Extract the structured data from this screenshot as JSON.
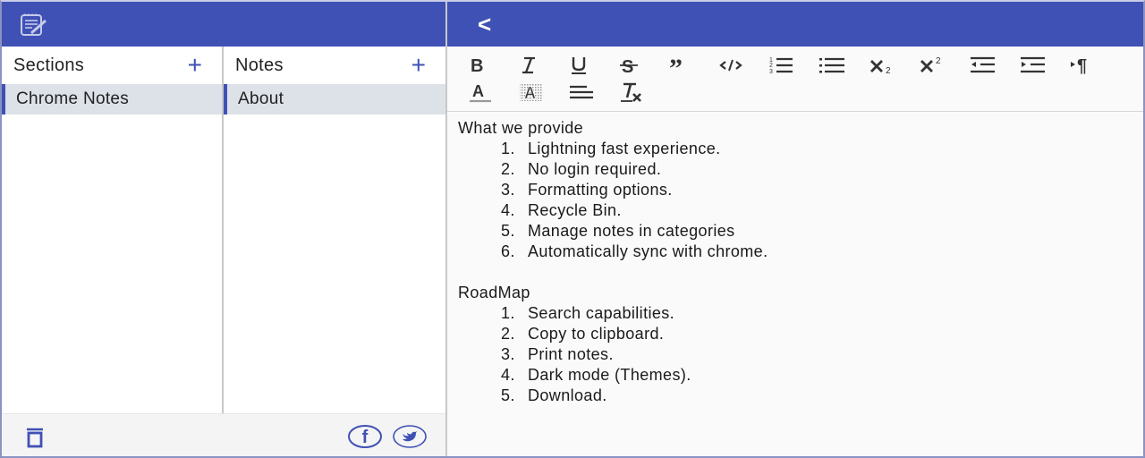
{
  "app": {
    "brand_color": "#3f51b5",
    "icon": "notepad-pencil-icon"
  },
  "sections": {
    "title": "Sections",
    "add_label": "+",
    "items": [
      {
        "label": "Chrome Notes",
        "selected": true
      }
    ]
  },
  "notes": {
    "title": "Notes",
    "add_label": "+",
    "items": [
      {
        "label": "About",
        "selected": true
      }
    ]
  },
  "footer": {
    "trash_icon": "trash-icon",
    "facebook_icon": "facebook-icon",
    "twitter_icon": "twitter-icon"
  },
  "header_right": {
    "back_label": "<"
  },
  "toolbar": {
    "row1": [
      "bold",
      "italic",
      "underline",
      "strikethrough",
      "blockquote",
      "code",
      "ordered-list",
      "bullet-list",
      "subscript",
      "superscript",
      "outdent",
      "indent",
      "text-direction"
    ],
    "row2": [
      "font-color",
      "background-color",
      "align-left",
      "clear-formatting"
    ]
  },
  "document": {
    "heading1": "What we provide",
    "list1": [
      {
        "num": "1.",
        "text": "Lightning fast experience."
      },
      {
        "num": "2.",
        "text": "No login required."
      },
      {
        "num": "3.",
        "text": "Formatting options."
      },
      {
        "num": "4.",
        "text": "Recycle Bin."
      },
      {
        "num": "5.",
        "text": "Manage notes in categories"
      },
      {
        "num": "6.",
        "text": "Automatically sync with chrome."
      }
    ],
    "heading2": "RoadMap",
    "list2": [
      {
        "num": "1.",
        "text": "Search capabilities."
      },
      {
        "num": "2.",
        "text": "Copy to clipboard."
      },
      {
        "num": "3.",
        "text": "Print notes."
      },
      {
        "num": "4.",
        "text": "Dark mode (Themes)."
      },
      {
        "num": "5.",
        "text": "Download."
      }
    ]
  }
}
